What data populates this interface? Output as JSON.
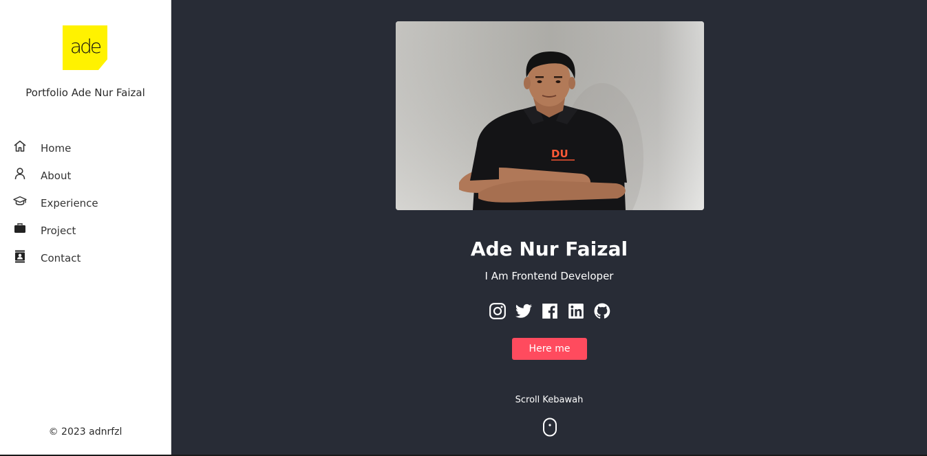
{
  "sidebar": {
    "logo_text": "ade",
    "brand_title": "Portfolio Ade Nur Faizal",
    "nav": [
      {
        "label": "Home",
        "icon": "home-icon"
      },
      {
        "label": "About",
        "icon": "user-icon"
      },
      {
        "label": "Experience",
        "icon": "graduation-cap-icon"
      },
      {
        "label": "Project",
        "icon": "briefcase-icon"
      },
      {
        "label": "Contact",
        "icon": "contact-book-icon"
      }
    ],
    "copyright": "© 2023 adnrfzl"
  },
  "hero": {
    "name": "Ade Nur Faizal",
    "role": "I Am Frontend Developer",
    "shirt_logo": "DU",
    "socials": [
      "instagram-icon",
      "twitter-icon",
      "facebook-icon",
      "linkedin-icon",
      "github-icon"
    ],
    "cta_label": "Here me",
    "scroll_text": "Scroll Kebawah"
  },
  "colors": {
    "sidebar_bg": "#ffffff",
    "main_bg": "#282c36",
    "accent": "#ff4b5e",
    "logo_bg": "#fff200"
  }
}
